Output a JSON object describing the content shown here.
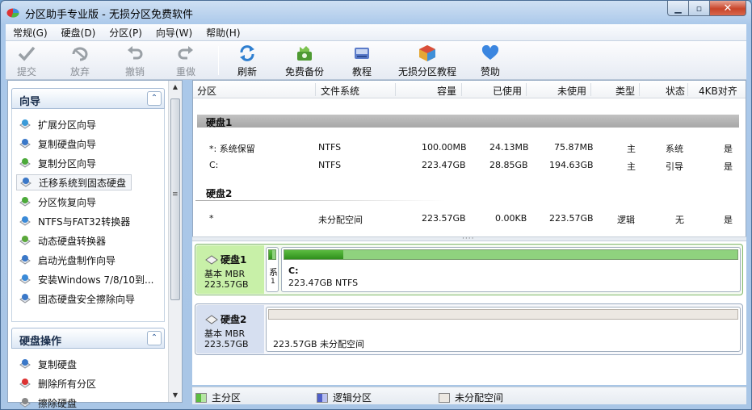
{
  "window": {
    "title": "分区助手专业版 - 无损分区免费软件"
  },
  "menu": [
    "常规(G)",
    "硬盘(D)",
    "分区(P)",
    "向导(W)",
    "帮助(H)"
  ],
  "toolbar": {
    "commit": "提交",
    "discard": "放弃",
    "undo": "撤销",
    "redo": "重做",
    "refresh": "刷新",
    "backup": "免费备份",
    "tutorial": "教程",
    "lossless": "无损分区教程",
    "donate": "赞助"
  },
  "wizard": {
    "title": "向导",
    "items": [
      "扩展分区向导",
      "复制硬盘向导",
      "复制分区向导",
      "迁移系统到固态硬盘",
      "分区恢复向导",
      "NTFS与FAT32转换器",
      "动态硬盘转换器",
      "启动光盘制作向导",
      "安装Windows 7/8/10到...",
      "固态硬盘安全擦除向导"
    ]
  },
  "disk_ops": {
    "title": "硬盘操作",
    "items": [
      "复制硬盘",
      "删除所有分区",
      "擦除硬盘"
    ]
  },
  "table": {
    "headers": [
      "分区",
      "文件系统",
      "容量",
      "已使用",
      "未使用",
      "类型",
      "状态",
      "4KB对齐"
    ],
    "disks": [
      {
        "label": "硬盘1",
        "rows": [
          [
            "*: 系统保留",
            "NTFS",
            "100.00MB",
            "24.13MB",
            "75.87MB",
            "主",
            "系统",
            "是"
          ],
          [
            "C:",
            "NTFS",
            "223.47GB",
            "28.85GB",
            "194.63GB",
            "主",
            "引导",
            "是"
          ]
        ]
      },
      {
        "label": "硬盘2",
        "rows": [
          [
            "*",
            "未分配空间",
            "223.57GB",
            "0.00KB",
            "223.57GB",
            "逻辑",
            "无",
            "是"
          ]
        ]
      }
    ]
  },
  "diskmap": [
    {
      "name": "硬盘1",
      "type": "基本 MBR",
      "size": "223.57GB",
      "small_part_label1": "系",
      "small_part_label2": "1",
      "part_label": "C:",
      "part_detail": "223.47GB NTFS",
      "used_fraction": 0.13
    },
    {
      "name": "硬盘2",
      "type": "基本 MBR",
      "size": "223.57GB",
      "part_detail": "223.57GB 未分配空间"
    }
  ],
  "legend": {
    "primary": "主分区",
    "logical": "逻辑分区",
    "unalloc": "未分配空间"
  },
  "colors": {
    "primary": "#5bbd40",
    "logical": "#4f5fc8",
    "unalloc": "#ece8e2",
    "selected_disk": "#c8f0a8"
  }
}
